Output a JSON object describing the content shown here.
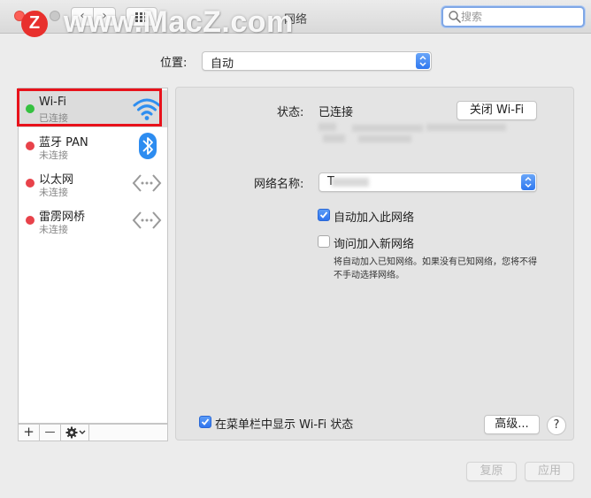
{
  "window": {
    "title": "网络"
  },
  "watermark": {
    "logo": "Z",
    "text": "www.MacZ.com"
  },
  "toolbar": {
    "back_label": "‹",
    "forward_label": "›",
    "search_placeholder": "搜索"
  },
  "location": {
    "label": "位置:",
    "value": "自动"
  },
  "services": [
    {
      "name": "Wi-Fi",
      "status": "已连接",
      "status_color": "#35c140",
      "icon": "wifi-icon"
    },
    {
      "name": "蓝牙 PAN",
      "status": "未连接",
      "status_color": "#e8424a",
      "icon": "bluetooth-icon"
    },
    {
      "name": "以太网",
      "status": "未连接",
      "status_color": "#e8424a",
      "icon": "ethernet-icon"
    },
    {
      "name": "雷雳网桥",
      "status": "未连接",
      "status_color": "#e8424a",
      "icon": "thunderbolt-bridge-icon"
    }
  ],
  "sidebar_tools": {
    "add": "+",
    "remove": "—"
  },
  "detail": {
    "status_label": "状态:",
    "status_value": "已连接",
    "turn_off_button": "关闭 Wi-Fi",
    "network_name_label": "网络名称:",
    "network_name_value": "T",
    "auto_join_label": "自动加入此网络",
    "auto_join_checked": true,
    "ask_join_label": "询问加入新网络",
    "ask_join_checked": false,
    "ask_join_description": "将自动加入已知网络。如果没有已知网络，您将不得不手动选择网络。",
    "show_menubar_label": "在菜单栏中显示 Wi-Fi 状态",
    "show_menubar_checked": true,
    "advanced_button": "高级...",
    "help_button": "?"
  },
  "footer": {
    "revert_button": "复原",
    "apply_button": "应用"
  },
  "colors": {
    "accent": "#2f78f0",
    "highlight_border": "#e8121b"
  }
}
